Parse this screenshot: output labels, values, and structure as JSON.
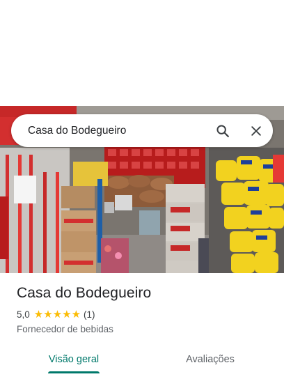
{
  "search": {
    "value": "Casa do Bodegueiro",
    "search_icon": "search-icon",
    "close_icon": "close-icon"
  },
  "photo": {
    "description_icon": "storefront-photo"
  },
  "place": {
    "name": "Casa do Bodegueiro",
    "rating": "5,0",
    "stars": 5,
    "review_count": "(1)",
    "category": "Fornecedor de bebidas"
  },
  "tabs": [
    {
      "label": "Visão geral",
      "active": true
    },
    {
      "label": "Avaliações",
      "active": false
    }
  ],
  "colors": {
    "accent": "#00796b",
    "star": "#fbbc04",
    "text": "#202124",
    "secondary_text": "#5f6368"
  }
}
